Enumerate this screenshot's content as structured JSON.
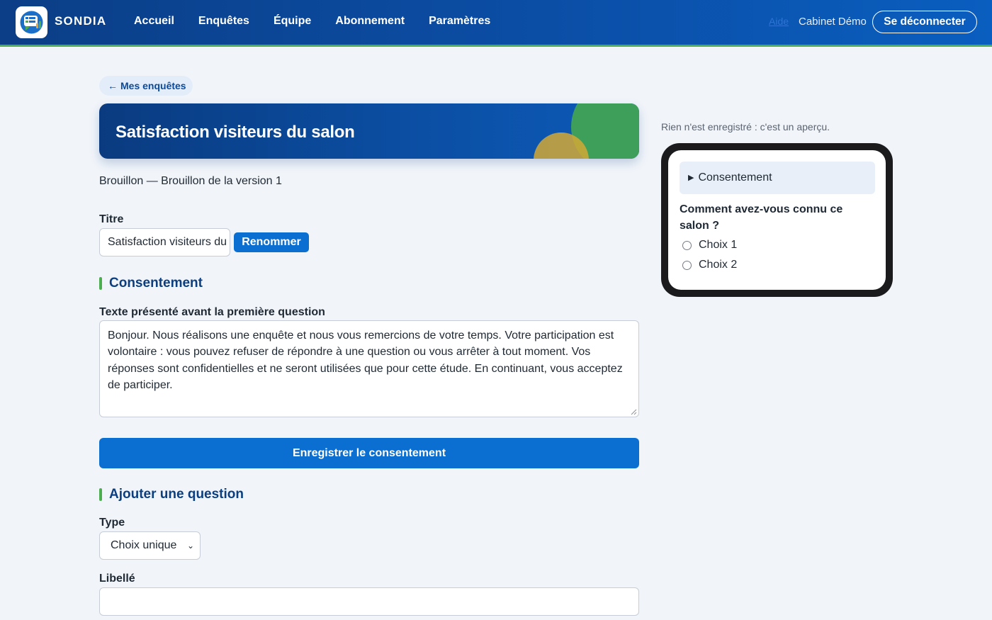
{
  "header": {
    "brand": "SONDIA",
    "nav": [
      "Accueil",
      "Enquêtes",
      "Équipe",
      "Abonnement",
      "Paramètres"
    ],
    "help": "Aide",
    "account": "Cabinet Démo",
    "logout": "Se déconnecter"
  },
  "colors": {
    "header": "#0b4ea6",
    "accent_green": "#4cae4f",
    "primary_button": "#0b6fd1",
    "section_title": "#0b3f7f"
  },
  "back": {
    "arrow": "←",
    "label": "Mes enquêtes"
  },
  "survey": {
    "title": "Satisfaction visiteurs du salon",
    "status": "Brouillon — Brouillon de la version 1"
  },
  "title_field": {
    "label": "Titre",
    "value": "Satisfaction visiteurs du salon",
    "rename_button": "Renommer"
  },
  "consent_section": {
    "heading": "Consentement",
    "field_label": "Texte présenté avant la première question",
    "text": "Bonjour. Nous réalisons une enquête et nous vous remercions de votre temps. Votre participation est volontaire : vous pouvez refuser de répondre à une question ou vous arrêter à tout moment. Vos réponses sont confidentielles et ne seront utilisées que pour cette étude. En continuant, vous acceptez de participer.",
    "save_button": "Enregistrer le consentement"
  },
  "add_question": {
    "heading": "Ajouter une question",
    "type_label": "Type",
    "type_value": "Choix unique",
    "libelle_label": "Libellé",
    "libelle_value": ""
  },
  "preview": {
    "note": "Rien n'est enregistré : c'est un aperçu.",
    "consent_toggle_icon": "▶",
    "consent_label": "Consentement",
    "question": "Comment avez-vous connu ce salon ?",
    "choices": [
      "Choix 1",
      "Choix 2"
    ]
  }
}
